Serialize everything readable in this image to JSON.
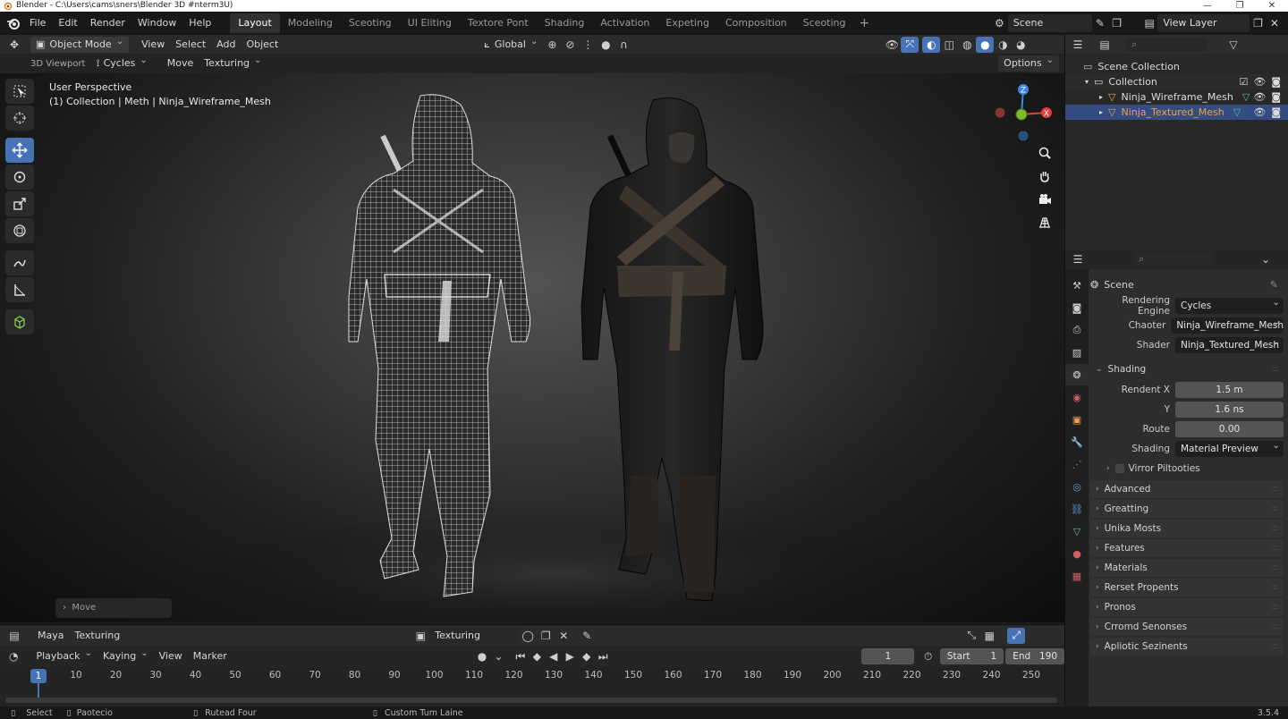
{
  "window": {
    "title": "Blender - C:\\Users\\cams\\sners\\Blender 3D #nterm3U)",
    "minimize": "—",
    "maximize": "❐",
    "close": "✕"
  },
  "menu": [
    "File",
    "Edit",
    "Render",
    "Window",
    "Help"
  ],
  "workspace_tabs": [
    "Layout",
    "Modeling",
    "Sceoting",
    "UI Eliting",
    "Textore Pont",
    "Shading",
    "Activation",
    "Expeting",
    "Composition",
    "Sceoting"
  ],
  "workspace_add": "+",
  "scene": {
    "name": "Scene",
    "view_layer": "View Layer"
  },
  "viewport_header": {
    "mode": "Object Mode",
    "menus": [
      "View",
      "Select",
      "Add",
      "Object"
    ],
    "transform_orientation": "Global"
  },
  "viewport_subheader": {
    "editor_label": "3D Viewport",
    "render_engine": "Cycles",
    "tool": "Move",
    "workspace": "Texturing",
    "options": "Options"
  },
  "viewport": {
    "perspective": "User Perspective",
    "collection_info": "(1) Collection | Meth | Ninja_Wireframe_Mesh",
    "last_operation": "Move",
    "gizmo_axes": {
      "z": "Z",
      "x": "X"
    }
  },
  "outliner": {
    "root": "Scene Collection",
    "collection": "Collection",
    "objects": [
      {
        "name": "Ninja_Wireframe_Mesh",
        "selected": false
      },
      {
        "name": "Ninja_Textured_Mesh",
        "selected": true
      }
    ]
  },
  "properties": {
    "context": "Scene",
    "rows": [
      {
        "label": "Rendering Engine",
        "value": "Cycles"
      },
      {
        "label": "Chaoter",
        "value": "Ninja_Wireframe_Mesh"
      },
      {
        "label": "Shader",
        "value": "Ninja_Textured_Mesh"
      }
    ],
    "shading_section": "Shading",
    "shading_rows": [
      {
        "label": "Rendent X",
        "value": "1.5 m"
      },
      {
        "label": "Y",
        "value": "1.6 ns"
      },
      {
        "label": "Route",
        "value": "0.00"
      }
    ],
    "shading_mode_label": "Shading",
    "shading_mode_value": "Material Preview",
    "checkbox_label": "Virror Piltooties",
    "sections": [
      "Advanced",
      "Greatting",
      "Unika Mosts",
      "Features",
      "Materials",
      "Rerset Propents",
      "Pronos",
      "Crromd Senonses",
      "Apliotic Sezinents"
    ]
  },
  "timeline_header": {
    "menu1": "Maya",
    "menu2": "Texturing",
    "action_name": "Texturing"
  },
  "timeline_controls": {
    "playback": "Playback",
    "keying": "Kaying",
    "view": "View",
    "marker": "Marker",
    "current_frame": "1",
    "start_label": "Start",
    "start_value": "1",
    "end_label": "End",
    "end_value": "190"
  },
  "timeline_ruler": {
    "current": "1",
    "ticks": [
      "10",
      "20",
      "30",
      "40",
      "50",
      "60",
      "70",
      "80",
      "90",
      "100",
      "110",
      "120",
      "130",
      "140",
      "150",
      "160",
      "170",
      "180",
      "190",
      "200",
      "210",
      "220",
      "230",
      "240",
      "250"
    ]
  },
  "statusbar": {
    "items": [
      "Select",
      "Paotecio",
      "Rutead Four",
      "Custom Tum Laine"
    ],
    "version": "3.5.4"
  },
  "colors": {
    "accent": "#4772b3",
    "selected_row": "#334d80",
    "axis_x": "#e0403f",
    "axis_y": "#7fba2d",
    "axis_z": "#3b86e0"
  }
}
